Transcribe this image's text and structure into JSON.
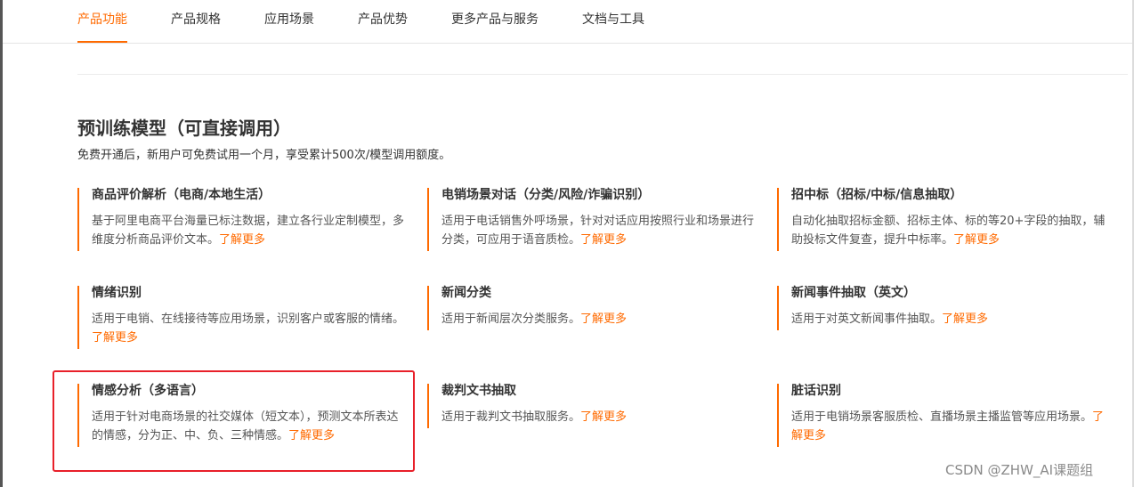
{
  "tabs": [
    {
      "label": "产品功能",
      "active": true
    },
    {
      "label": "产品规格"
    },
    {
      "label": "应用场景"
    },
    {
      "label": "产品优势"
    },
    {
      "label": "更多产品与服务"
    },
    {
      "label": "文档与工具"
    }
  ],
  "section": {
    "title": "预训练模型（可直接调用）",
    "desc": "免费开通后，新用户可免费试用一个月，享受累计500次/模型调用额度。"
  },
  "more_label": "了解更多",
  "cards": [
    {
      "title": "商品评价解析（电商/本地生活）",
      "desc": "基于阿里电商平台海量已标注数据，建立各行业定制模型，多维度分析商品评价文本。"
    },
    {
      "title": "电销场景对话（分类/风险/诈骗识别）",
      "desc": "适用于电话销售外呼场景，针对对话应用按照行业和场景进行分类，可应用于语音质检。"
    },
    {
      "title": "招中标（招标/中标/信息抽取）",
      "desc": "自动化抽取招标金额、招标主体、标的等20+字段的抽取，辅助投标文件复查，提升中标率。"
    },
    {
      "title": "情绪识别",
      "desc": "适用于电销、在线接待等应用场景，识别客户或客服的情绪。"
    },
    {
      "title": "新闻分类",
      "desc": "适用于新闻层次分类服务。"
    },
    {
      "title": "新闻事件抽取（英文）",
      "desc": "适用于对英文新闻事件抽取。"
    },
    {
      "title": "情感分析（多语言）",
      "desc": "适用于针对电商场景的社交媒体（短文本），预测文本所表达的情感，分为正、中、负、三种情感。"
    },
    {
      "title": "裁判文书抽取",
      "desc": "适用于裁判文书抽取服务。"
    },
    {
      "title": "脏话识别",
      "desc": "适用于电销场景客服质检、直播场景主播监管等应用场景。"
    }
  ],
  "watermark": "CSDN @ZHW_AI课题组",
  "colors": {
    "accent": "#ff6a00",
    "highlight": "#e8202a"
  }
}
